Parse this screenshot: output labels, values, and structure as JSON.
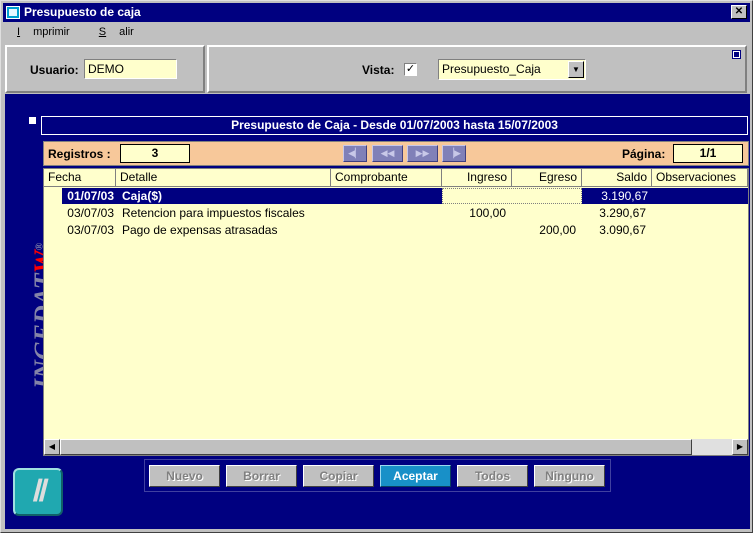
{
  "window": {
    "title": "Presupuesto de caja",
    "close_glyph": "✕"
  },
  "menu": [
    {
      "label": "Imprimir",
      "accel": "I",
      "rest": "mprimir"
    },
    {
      "label": "Salir",
      "accel": "S",
      "rest": "alir"
    }
  ],
  "filters": {
    "usuario_label": "Usuario:",
    "usuario_value": "DEMO",
    "vista_label": "Vista:",
    "vista_checked": "✓",
    "vista_value": "Presupuesto_Caja",
    "dropdown_glyph": "▼"
  },
  "brand": {
    "name_main": "INGEDAT",
    "name_accent": "W",
    "reg": "®",
    "logo_glyph": "Ⅱ"
  },
  "report": {
    "title": "Presupuesto de Caja - Desde 01/07/2003 hasta 15/07/2003",
    "registros_label": "Registros :",
    "registros_value": "3",
    "pagina_label": "Página:",
    "pagina_value": "1/1",
    "nav": [
      "◀▏",
      "◀◀",
      "▶▶",
      "▕▶"
    ]
  },
  "grid": {
    "columns": [
      "Fecha",
      "Detalle",
      "Comprobante",
      "Ingreso",
      "Egreso",
      "Saldo",
      "Observaciones"
    ],
    "rows": [
      {
        "fecha": "01/07/03",
        "detalle": "Caja($)",
        "comprobante": "",
        "ingreso": "",
        "egreso": "",
        "saldo": "3.190,67",
        "observaciones": ""
      },
      {
        "fecha": "03/07/03",
        "detalle": "Retencion para impuestos fiscales",
        "comprobante": "",
        "ingreso": "100,00",
        "egreso": "",
        "saldo": "3.290,67",
        "observaciones": ""
      },
      {
        "fecha": "03/07/03",
        "detalle": "Pago de expensas atrasadas",
        "comprobante": "",
        "ingreso": "",
        "egreso": "200,00",
        "saldo": "3.090,67",
        "observaciones": ""
      }
    ],
    "scroll_left": "◀",
    "scroll_right": "▶"
  },
  "actions": [
    "Nuevo",
    "Borrar",
    "Copiar",
    "Aceptar",
    "Todos",
    "Ninguno"
  ],
  "colors": {
    "title_blue": "#000080",
    "field_yellow": "#ffffcc",
    "navbar_peach": "#f7c89a",
    "accept_blue": "#1890c8"
  }
}
